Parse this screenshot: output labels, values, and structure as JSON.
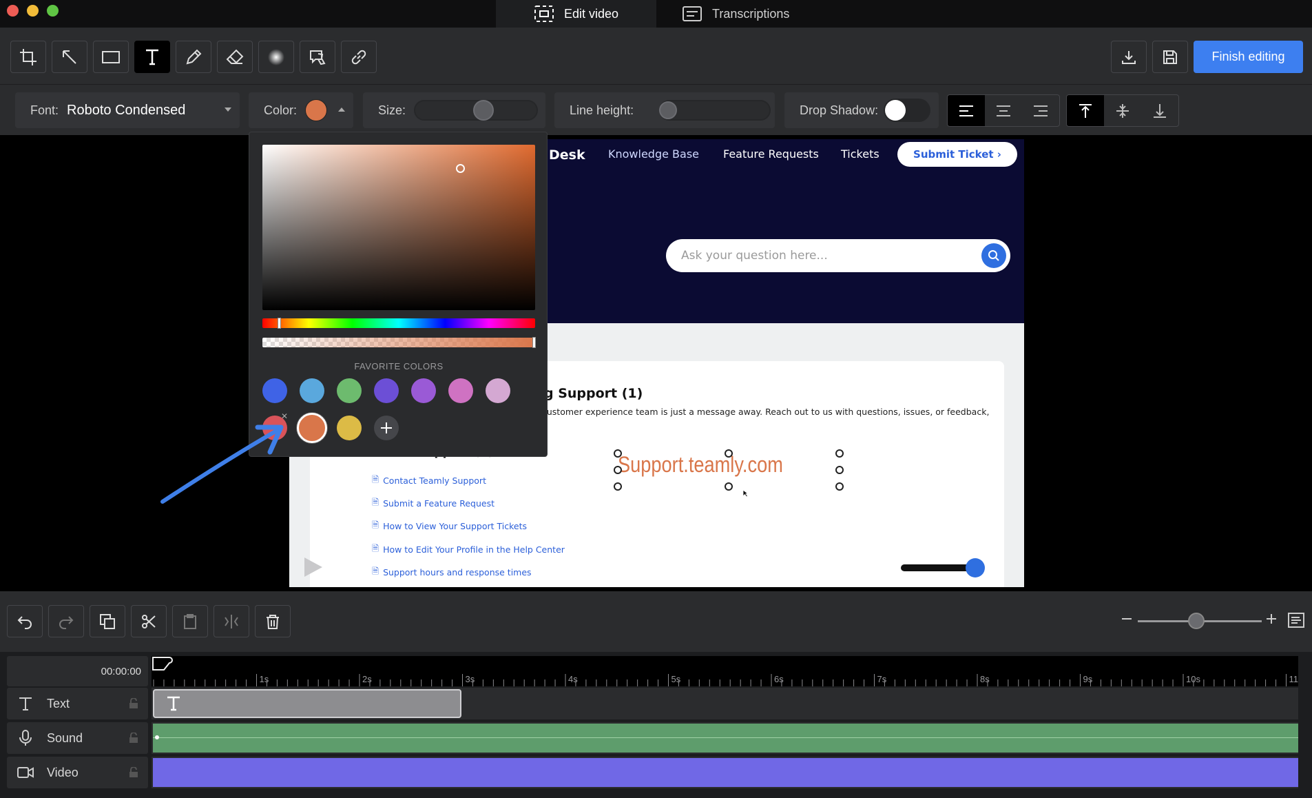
{
  "tabs": [
    {
      "label": "Edit video",
      "icon": "edit-video-icon",
      "active": true
    },
    {
      "label": "Transcriptions",
      "icon": "transcriptions-icon",
      "active": false
    }
  ],
  "toolbar": {
    "tools": [
      "crop-icon",
      "arrow-icon",
      "rectangle-icon",
      "text-icon",
      "pen-icon",
      "eraser-icon",
      "blur-icon",
      "highlight-icon",
      "link-icon"
    ],
    "active_tool": "text-icon",
    "finish_label": "Finish editing"
  },
  "props": {
    "font_label": "Font:",
    "font_value": "Roboto Condensed",
    "color_label": "Color:",
    "color_value": "#d9764a",
    "size_label": "Size:",
    "line_height_label": "Line height:",
    "drop_shadow_label": "Drop Shadow:",
    "drop_shadow_on": false
  },
  "picker": {
    "favorite_label": "FAVORITE COLORS",
    "favorites": [
      "#3f63e6",
      "#5aa8dd",
      "#6dbb6e",
      "#6c4fd6",
      "#9a5ad6",
      "#cf72c2",
      "#d4a8d2",
      "#d9535a",
      "#d9764a",
      "#dcbb46"
    ],
    "selected": "#d9764a"
  },
  "video": {
    "brand_partial": "Desk",
    "nav": [
      "Knowledge Base",
      "Feature Requests",
      "Tickets"
    ],
    "submit_ticket": "Submit Ticket ›",
    "search_placeholder": "Ask your question here...",
    "section_title": "g Support (1)",
    "section_desc": "customer experience team is just a message away. Reach out to us with questions, issues, or feedback,",
    "section_partial": "Customer Support (5)",
    "links": [
      "Contact Teamly Support",
      "Submit a Feature Request",
      "How to View Your Support Tickets",
      "How to Edit Your Profile in the Help Center",
      "Support hours and response times"
    ],
    "overlay_text": "Support.teamly.com"
  },
  "timeline": {
    "time": "00:00:00",
    "ruler_labels": [
      "1s",
      "2s",
      "3s",
      "4s",
      "5s",
      "6s",
      "7s",
      "8s",
      "9s",
      "10s",
      "11"
    ],
    "tracks": [
      {
        "name": "Text",
        "icon": "text-track-icon"
      },
      {
        "name": "Sound",
        "icon": "microphone-icon"
      },
      {
        "name": "Video",
        "icon": "camera-icon"
      }
    ]
  }
}
